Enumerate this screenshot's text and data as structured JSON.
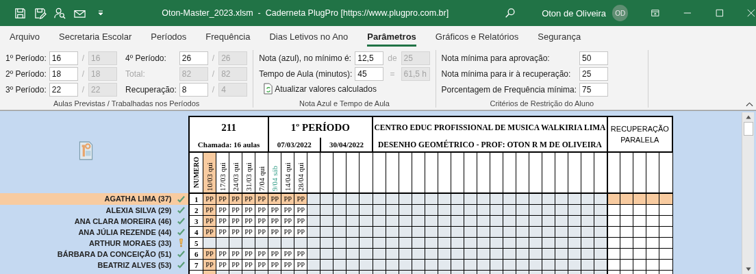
{
  "window": {
    "title": "Oton-Master_2023.xlsm  -  Caderneta PlugPro [https://www.plugpro.com.br]",
    "user": "Oton de Oliveira",
    "avatar": "OD"
  },
  "tabs": [
    {
      "label": "Arquivo",
      "selected": false
    },
    {
      "label": "Secretaria Escolar",
      "selected": false
    },
    {
      "label": "Períodos",
      "selected": false
    },
    {
      "label": "Frequência",
      "selected": false
    },
    {
      "label": "Dias Letivos no Ano",
      "selected": false
    },
    {
      "label": "Parâmetros",
      "selected": true
    },
    {
      "label": "Gráficos e Relatórios",
      "selected": false
    },
    {
      "label": "Segurança",
      "selected": false
    }
  ],
  "groups": [
    {
      "title": "Aulas Previstas / Trabalhadas nos Períodos",
      "fields": [
        {
          "label": "1º Período:",
          "value": "16",
          "disabled": false,
          "separator": "/",
          "computed": "16"
        },
        {
          "label": "2º Período:",
          "value": "18",
          "disabled": false,
          "separator": "/",
          "computed": "18"
        },
        {
          "label": "3º Período:",
          "value": "22",
          "disabled": false,
          "separator": "/",
          "computed": "22"
        },
        {
          "label": "4º Período:",
          "value": "26",
          "disabled": false,
          "separator": "/",
          "computed": "26"
        },
        {
          "label": "Total:",
          "value": "82",
          "disabled": true,
          "separator": "/",
          "computed": "82"
        },
        {
          "label": "Recuperação:",
          "value": "8",
          "disabled": false,
          "separator": "/",
          "computed": "4"
        }
      ]
    },
    {
      "title": "Nota Azul e Tempo de Aula",
      "fields": [
        {
          "label": "Nota (azul), no mínimo é:",
          "value": "12,5",
          "disabled": false,
          "separator": "de",
          "computed": "25"
        },
        {
          "label": "Tempo de Aula (minutos):",
          "value": "45",
          "disabled": false,
          "separator": "=",
          "computed": "61,5 h"
        }
      ],
      "button": "Atualizar valores calculados"
    },
    {
      "title": "Critérios de Restrição do Aluno",
      "fields": [
        {
          "label": "Nota mínima para aprovação:",
          "value": "50",
          "disabled": false
        },
        {
          "label": "Nota mínima para ir à recuperação:",
          "value": "25",
          "disabled": false
        },
        {
          "label": "Porcentagem de Frequência mínima:",
          "value": "75",
          "disabled": false
        }
      ]
    }
  ],
  "sheet": {
    "class_name": "211",
    "period_title": "1º PERÍODO",
    "school": "CENTRO EDUC PROFISSIONAL DE MUSICA WALKIRIA LIMA",
    "attendance": "Chamada: 16 aulas",
    "start_date": "07/03/2022",
    "end_date": "30/04/2022",
    "subject": "DESENHO GEOMÉTRICO - PROF: OTON R M DE OLIVEIRA",
    "recovery_title": "RECUPERAÇÃO PARALELA",
    "number_header": "NUMERO",
    "dates": [
      {
        "label": "10/03 qui",
        "selected": true,
        "kind": "weekday"
      },
      {
        "label": "17/03 qui",
        "selected": false,
        "kind": "weekday"
      },
      {
        "label": "24/03 qui",
        "selected": false,
        "kind": "weekday"
      },
      {
        "label": "31/03 qui",
        "selected": false,
        "kind": "weekday"
      },
      {
        "label": "7/04 qui",
        "selected": false,
        "kind": "weekday"
      },
      {
        "label": "9/04 sáb",
        "selected": false,
        "kind": "weekend"
      },
      {
        "label": "14/04 qui",
        "selected": false,
        "kind": "weekday"
      },
      {
        "label": "28/04 qui",
        "selected": false,
        "kind": "weekday"
      }
    ],
    "students": [
      {
        "name": "AGATHA LIMA (37)",
        "kind": "ok",
        "number": "1",
        "selected": true,
        "marks": [
          "PP",
          "PP",
          "PP",
          "PP",
          "PP",
          "PP",
          "PP",
          "PP"
        ]
      },
      {
        "name": "ALEXIA SILVA (29)",
        "kind": "ok",
        "number": "2",
        "selected": false,
        "marks": [
          "PP",
          "PP",
          "PP",
          "PP",
          "PP",
          "PP",
          "PP",
          "PP"
        ]
      },
      {
        "name": "ANA CLARA MOREIRA (46)",
        "kind": "ok",
        "number": "3",
        "selected": false,
        "marks": [
          "PP",
          "PP",
          "PP",
          "PP",
          "PP",
          "PP",
          "PP",
          "PP"
        ]
      },
      {
        "name": "ANA JÚLIA REZENDE (44)",
        "kind": "ok",
        "number": "4",
        "selected": false,
        "marks": [
          "PP",
          "PP",
          "PP",
          "PP",
          "PP",
          "PP",
          "PP",
          "PP"
        ]
      },
      {
        "name": "ARTHUR MORAES (33)",
        "kind": "warning",
        "number": "5",
        "selected": false
      },
      {
        "name": "BÁRBARA DA CONCEIÇÃO (51)",
        "kind": "ok",
        "number": "6",
        "selected": false,
        "marks": [
          "PP",
          "PP",
          "PP",
          "PP",
          "PP",
          "PP",
          "PP",
          "PP"
        ]
      },
      {
        "name": "BEATRIZ ALVES (53)",
        "kind": "ok",
        "number": "7",
        "selected": false,
        "marks": [
          "PP",
          "PP",
          "PP",
          "PP",
          "PP",
          "PP",
          "PP",
          "PP"
        ]
      }
    ]
  }
}
